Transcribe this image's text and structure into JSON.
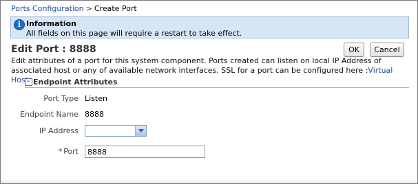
{
  "breadcrumb": {
    "parent": "Ports Configuration",
    "separator": ">",
    "current": "Create Port"
  },
  "info": {
    "icon": "info-icon",
    "title": "Information",
    "message": "All fields on this page will require a restart to take effect."
  },
  "page": {
    "title": "Edit Port : 8888",
    "description": "Edit attributes of a port for this system component. Ports created can listen on local IP Address of associated host or any of available network interfaces. SSL for a port can be configured here :",
    "description_link": "Virtual Hosts"
  },
  "buttons": {
    "ok": "OK",
    "cancel": "Cancel"
  },
  "section": {
    "collapse_glyph": "−",
    "title": "Endpoint Attributes"
  },
  "fields": {
    "port_type": {
      "label": "Port Type",
      "value": "Listen"
    },
    "endpoint_name": {
      "label": "Endpoint Name",
      "value": "8888"
    },
    "ip_address": {
      "label": "IP Address",
      "value": ""
    },
    "port": {
      "required_mark": "*",
      "label": "Port",
      "value": "8888"
    }
  },
  "colors": {
    "link": "#1f4ea1",
    "info_background": "#d7e6f5",
    "section_rule": "#a7b8cf"
  }
}
